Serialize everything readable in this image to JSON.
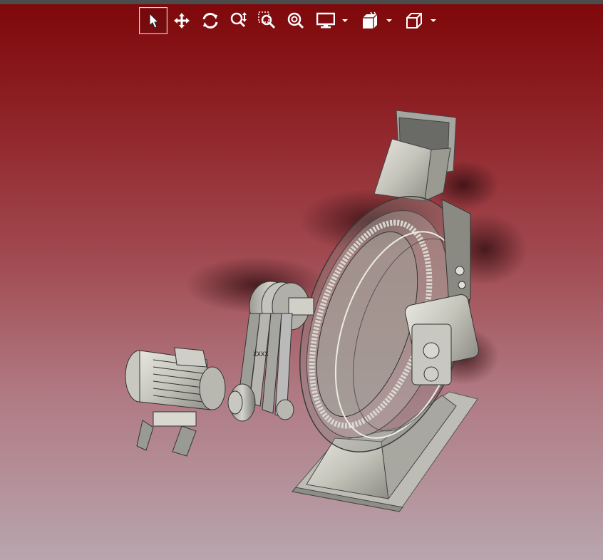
{
  "viewport": {
    "background_top": "#7e0709",
    "background_bottom": "#b8a5ae"
  },
  "toolbar": {
    "items": [
      {
        "name": "select",
        "icon": "select-arrow-icon",
        "active": true
      },
      {
        "name": "pan",
        "icon": "pan-arrows-icon",
        "active": false
      },
      {
        "name": "rotate",
        "icon": "rotate-icon",
        "active": false
      },
      {
        "name": "zoom-dynamic",
        "icon": "zoom-dynamic-icon",
        "active": false
      },
      {
        "name": "zoom-window",
        "icon": "zoom-window-icon",
        "active": false
      },
      {
        "name": "zoom-fit",
        "icon": "zoom-fit-icon",
        "active": false
      },
      {
        "name": "display-style",
        "icon": "monitor-icon",
        "dropdown": true
      },
      {
        "name": "view-cube",
        "icon": "view-cube-icon",
        "dropdown": true
      },
      {
        "name": "view-orientation",
        "icon": "box-icon",
        "dropdown": true
      }
    ]
  },
  "model": {
    "description_visible": false,
    "part_color": "#c9c9c1"
  }
}
